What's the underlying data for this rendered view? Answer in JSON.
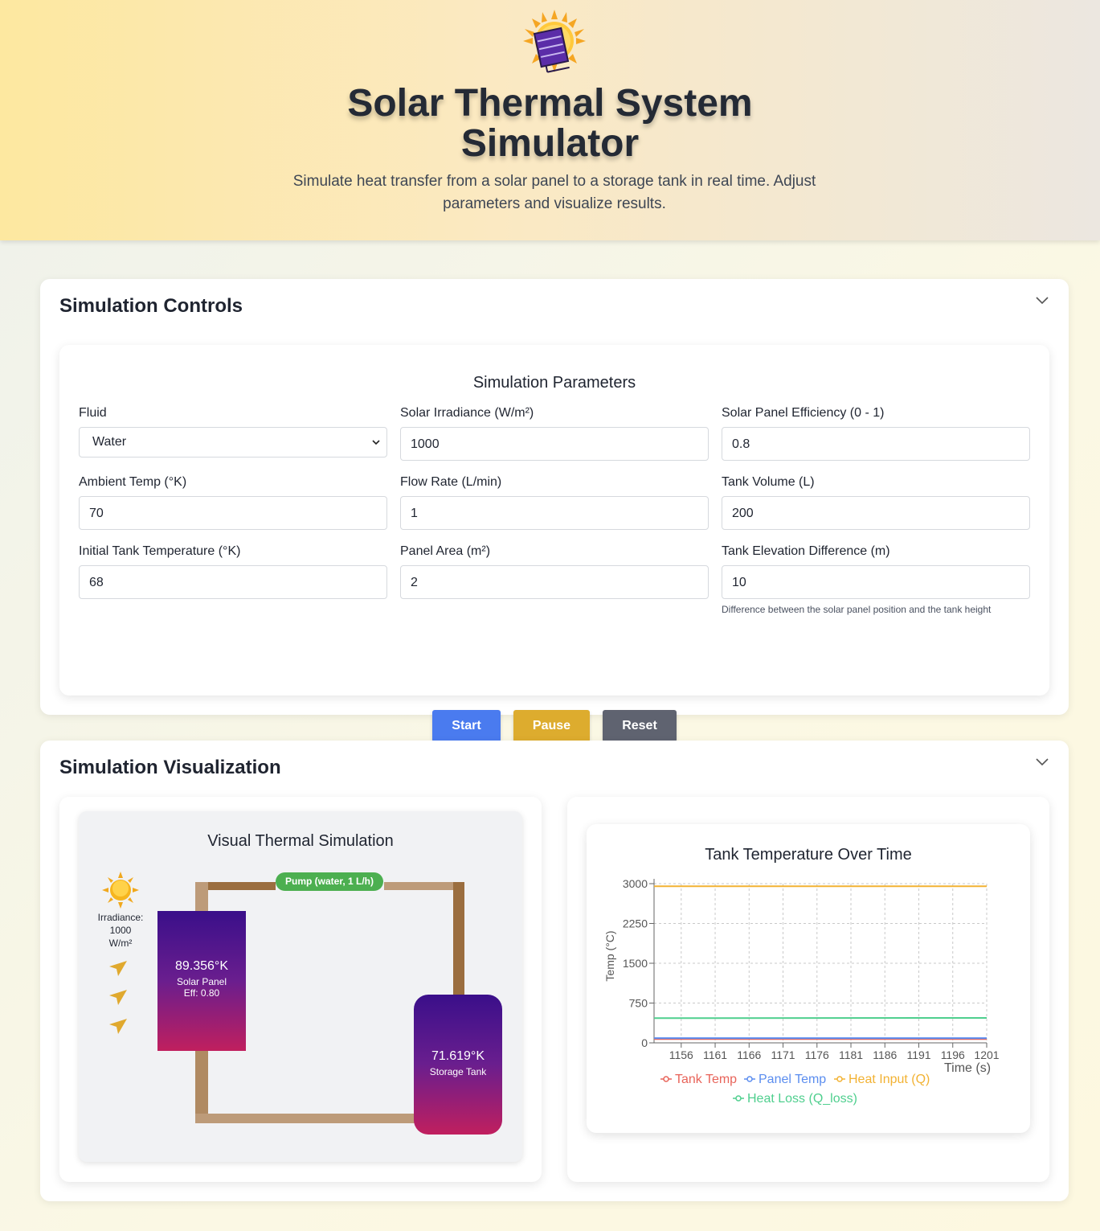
{
  "header": {
    "icon": "sun-solar-panel-icon",
    "title_line1": "Solar Thermal System",
    "title_line2": "Simulator",
    "subtitle": "Simulate heat transfer from a solar panel to a storage tank in real time. Adjust parameters and visualize results."
  },
  "controls": {
    "title": "Simulation Controls",
    "params_title": "Simulation Parameters",
    "fields": [
      {
        "label": "Fluid",
        "value": "Water",
        "type": "select"
      },
      {
        "label": "Solar Irradiance (W/m²)",
        "value": "1000"
      },
      {
        "label": "Solar Panel Efficiency (0 - 1)",
        "value": "0.8"
      },
      {
        "label": "Ambient Temp (°K)",
        "value": "70"
      },
      {
        "label": "Flow Rate (L/min)",
        "value": "1"
      },
      {
        "label": "Tank Volume (L)",
        "value": "200"
      },
      {
        "label": "Initial Tank Temperature (°K)",
        "value": "68"
      },
      {
        "label": "Panel Area (m²)",
        "value": "2"
      },
      {
        "label": "Tank Elevation Difference (m)",
        "value": "10"
      }
    ],
    "elevation_hint": "Difference between the solar panel position and the tank height",
    "buttons": {
      "start": "Start",
      "pause": "Pause",
      "reset": "Reset"
    },
    "colors": {
      "start": "#4a7bef",
      "pause": "#ddac2e",
      "reset": "#5f6370"
    }
  },
  "visualization": {
    "title": "Simulation Visualization",
    "sim_title": "Visual Thermal Simulation",
    "irradiance_label": "Irradiance:",
    "irradiance_value": "1000",
    "irradiance_unit": "W/m²",
    "panel": {
      "temp": "89.356°K",
      "label": "Solar Panel",
      "eff": "Eff: 0.80"
    },
    "tank": {
      "temp": "71.619°K",
      "label": "Storage Tank"
    },
    "pump": "Pump (water, 1 L/h)"
  },
  "chart_data": {
    "type": "line",
    "title": "Tank Temperature Over Time",
    "xlabel": "Time (s)",
    "ylabel": "Temp (°C)",
    "x_ticks": [
      "1156",
      "1161",
      "1166",
      "1171",
      "1176",
      "1181",
      "1186",
      "1191",
      "1196",
      "1201"
    ],
    "y_ticks": [
      "0",
      "750",
      "1500",
      "2250",
      "3000"
    ],
    "xlim": [
      1152,
      1201
    ],
    "ylim": [
      0,
      3000
    ],
    "grid": true,
    "legend_position": "bottom",
    "series": [
      {
        "name": "Tank Temp",
        "color": "#e8645a",
        "x": [
          1152,
          1201
        ],
        "values": [
          72,
          72
        ]
      },
      {
        "name": "Panel Temp",
        "color": "#5b8def",
        "x": [
          1152,
          1201
        ],
        "values": [
          89,
          89
        ]
      },
      {
        "name": "Heat Input (Q)",
        "color": "#f2b233",
        "x": [
          1152,
          1201
        ],
        "values": [
          2950,
          2950
        ]
      },
      {
        "name": "Heat Loss (Q_loss)",
        "color": "#4fcf8e",
        "x": [
          1152,
          1201
        ],
        "values": [
          465,
          470
        ]
      }
    ]
  }
}
